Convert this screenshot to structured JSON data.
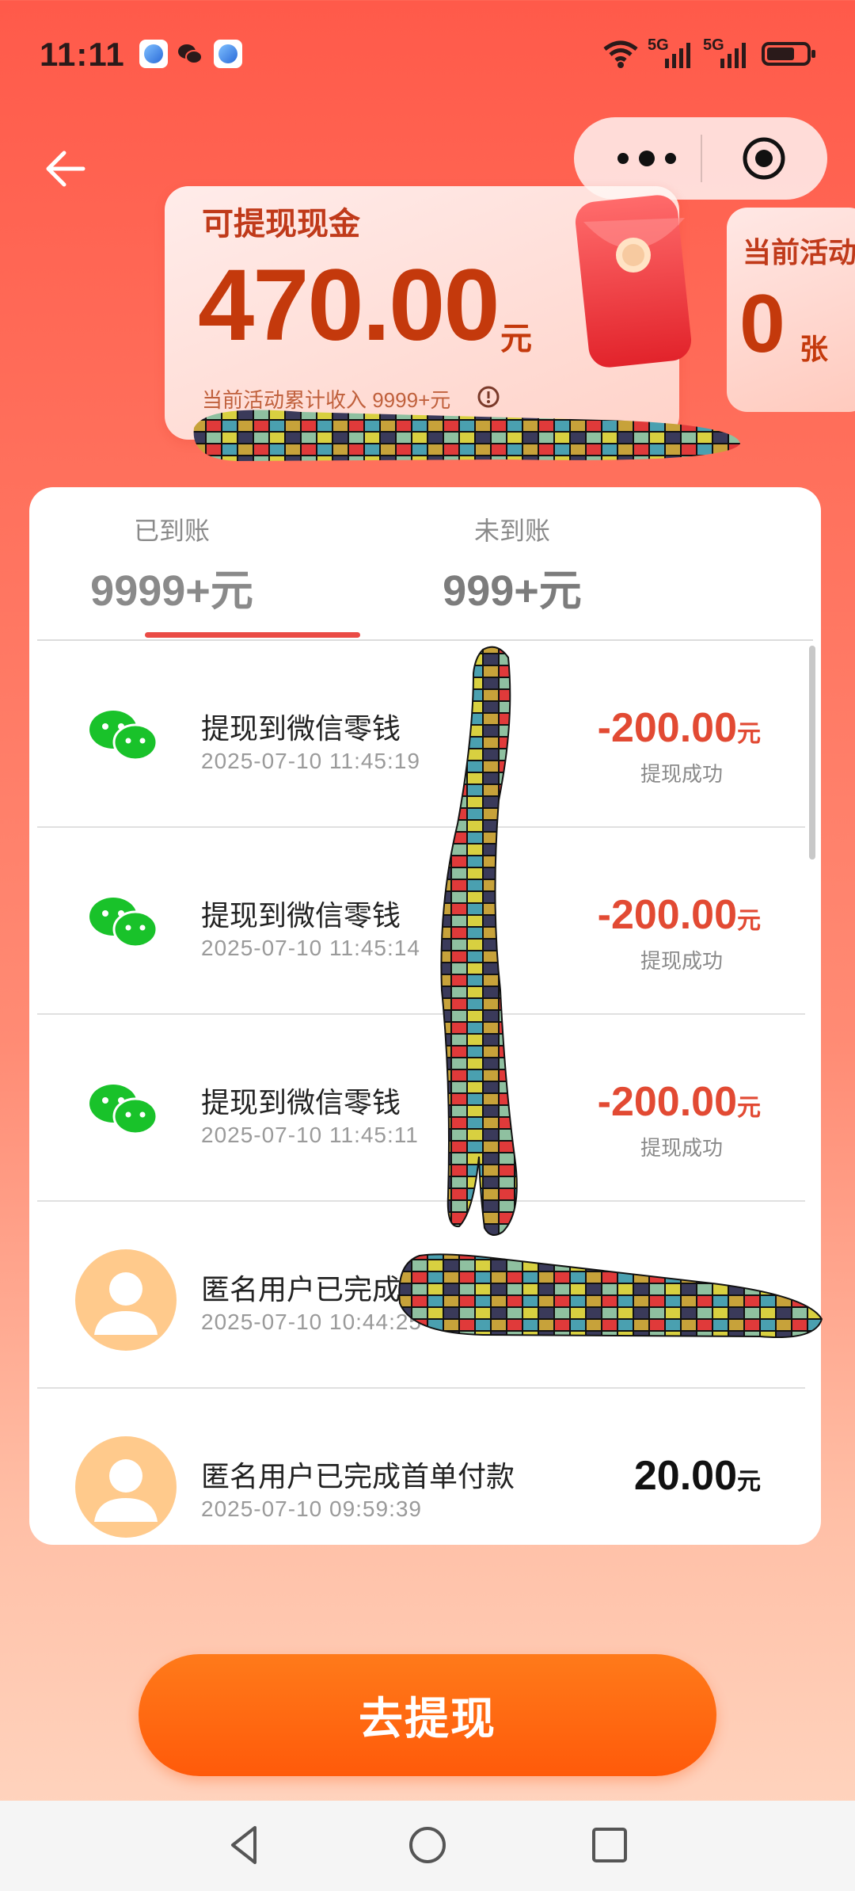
{
  "status_bar": {
    "time": "11:11",
    "network_1": "5G",
    "network_2": "5G"
  },
  "summary": {
    "cash_title": "可提现现金",
    "cash_amount": "470.00",
    "cash_unit": "元",
    "cash_note": "当前活动累计收入 9999+元",
    "coupon_title": "当前活动",
    "coupon_count": "0",
    "coupon_unit": "张"
  },
  "tabs": [
    {
      "label": "已到账",
      "value": "9999+元",
      "active": true
    },
    {
      "label": "未到账",
      "value": "999+元",
      "active": false
    }
  ],
  "records": [
    {
      "icon": "wechat-icon",
      "title": "提现到微信零钱",
      "time": "2025-07-10 11:45:19",
      "amount": "-200.00",
      "unit": "元",
      "status": "提现成功"
    },
    {
      "icon": "wechat-icon",
      "title": "提现到微信零钱",
      "time": "2025-07-10 11:45:14",
      "amount": "-200.00",
      "unit": "元",
      "status": "提现成功"
    },
    {
      "icon": "wechat-icon",
      "title": "提现到微信零钱",
      "time": "2025-07-10 11:45:11",
      "amount": "-200.00",
      "unit": "元",
      "status": "提现成功"
    },
    {
      "icon": "user-avatar-icon",
      "title": "匿名用户已完成首单付款",
      "time": "2025-07-10 10:44:25",
      "amount": "",
      "unit": "",
      "status": ""
    },
    {
      "icon": "user-avatar-icon",
      "title": "匿名用户已完成首单付款",
      "time": "2025-07-10 09:59:39",
      "amount": "20.00",
      "unit": "元",
      "status": ""
    }
  ],
  "cta": {
    "label": "去提现"
  },
  "colors": {
    "accent": "#e24a33",
    "button": "#ff6a10",
    "wechat": "#19c22a"
  }
}
